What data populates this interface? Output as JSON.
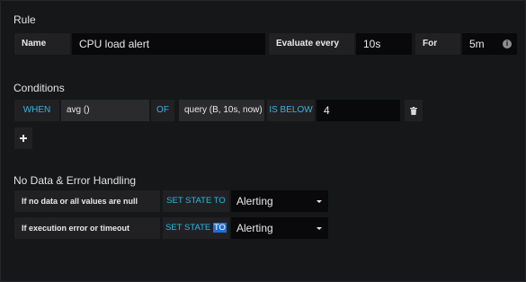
{
  "rule": {
    "title": "Rule",
    "name_label": "Name",
    "name_value": "CPU load alert",
    "evaluate_label": "Evaluate every",
    "evaluate_value": "10s",
    "for_label": "For",
    "for_value": "5m"
  },
  "conditions": {
    "title": "Conditions",
    "when": "WHEN",
    "func": "avg ()",
    "of": "OF",
    "query": "query (B, 10s, now)",
    "comparator": "IS BELOW",
    "threshold": "4",
    "add_label": "+"
  },
  "handling": {
    "title": "No Data & Error Handling",
    "rows": [
      {
        "label": "If no data or all values are null",
        "set_state": "SET STATE TO",
        "value": "Alerting"
      },
      {
        "label": "If execution error or timeout",
        "set_state_prefix": "SET STATE ",
        "set_state_highlight": "TO",
        "value": "Alerting"
      }
    ]
  },
  "icons": {
    "info": "info-icon",
    "delete": "trash-icon",
    "add": "plus-icon",
    "dropdown": "caret-down-icon"
  },
  "colors": {
    "keyword": "#33b5e5",
    "background": "#161719",
    "label_bg": "#212124",
    "input_bg": "#09090b",
    "selection": "#1f6fd6"
  }
}
